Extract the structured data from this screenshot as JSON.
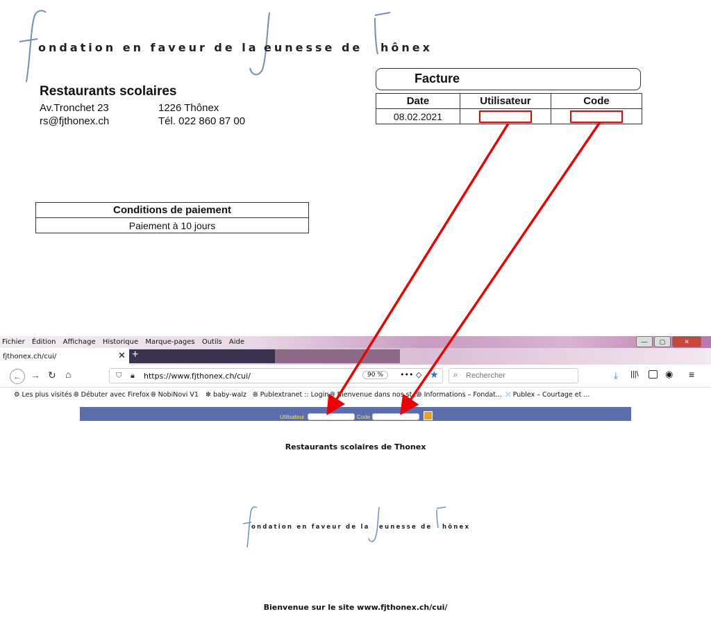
{
  "letterhead": {
    "logo_part1": "ondation en faveur de la",
    "logo_part2": "eunesse de",
    "logo_part3": "hônex",
    "org_name": "Restaurants scolaires",
    "street": "Av.Tronchet 23",
    "city": "1226 Thônex",
    "email": "rs@fjthonex.ch",
    "phone": "Tél. 022 860 87 00"
  },
  "invoice": {
    "title": "Facture",
    "headers": [
      "Date",
      "Utilisateur",
      "Code"
    ],
    "date": "08.02.2021"
  },
  "conditions": {
    "header": "Conditions de paiement",
    "value": "Paiement à 10 jours"
  },
  "browser": {
    "menu": [
      "Fichier",
      "Édition",
      "Affichage",
      "Historique",
      "Marque-pages",
      "Outils",
      "Aide"
    ],
    "active_tab": "fjthonex.ch/cui/",
    "url": "https://www.fjthonex.ch/cui/",
    "zoom": "90 %",
    "search_placeholder": "Rechercher",
    "bookmarks": [
      "Les plus visités",
      "Débuter avec Firefox",
      "NobiNovi V1",
      "baby-walz",
      "Publextranet :: Login",
      "Bienvenue dans nos st...",
      "Informations – Fondat...",
      "Publex – Courtage et ..."
    ]
  },
  "site": {
    "user_label": "Utilisateur",
    "code_label": "Code",
    "title": "Restaurants scolaires de Thonex",
    "welcome": "Bienvenue sur le site www.fjthonex.ch/cui/"
  },
  "colors": {
    "arrow": "#ee0000",
    "site_bar": "#5a6dad",
    "label_yellow": "#f5e35b"
  }
}
